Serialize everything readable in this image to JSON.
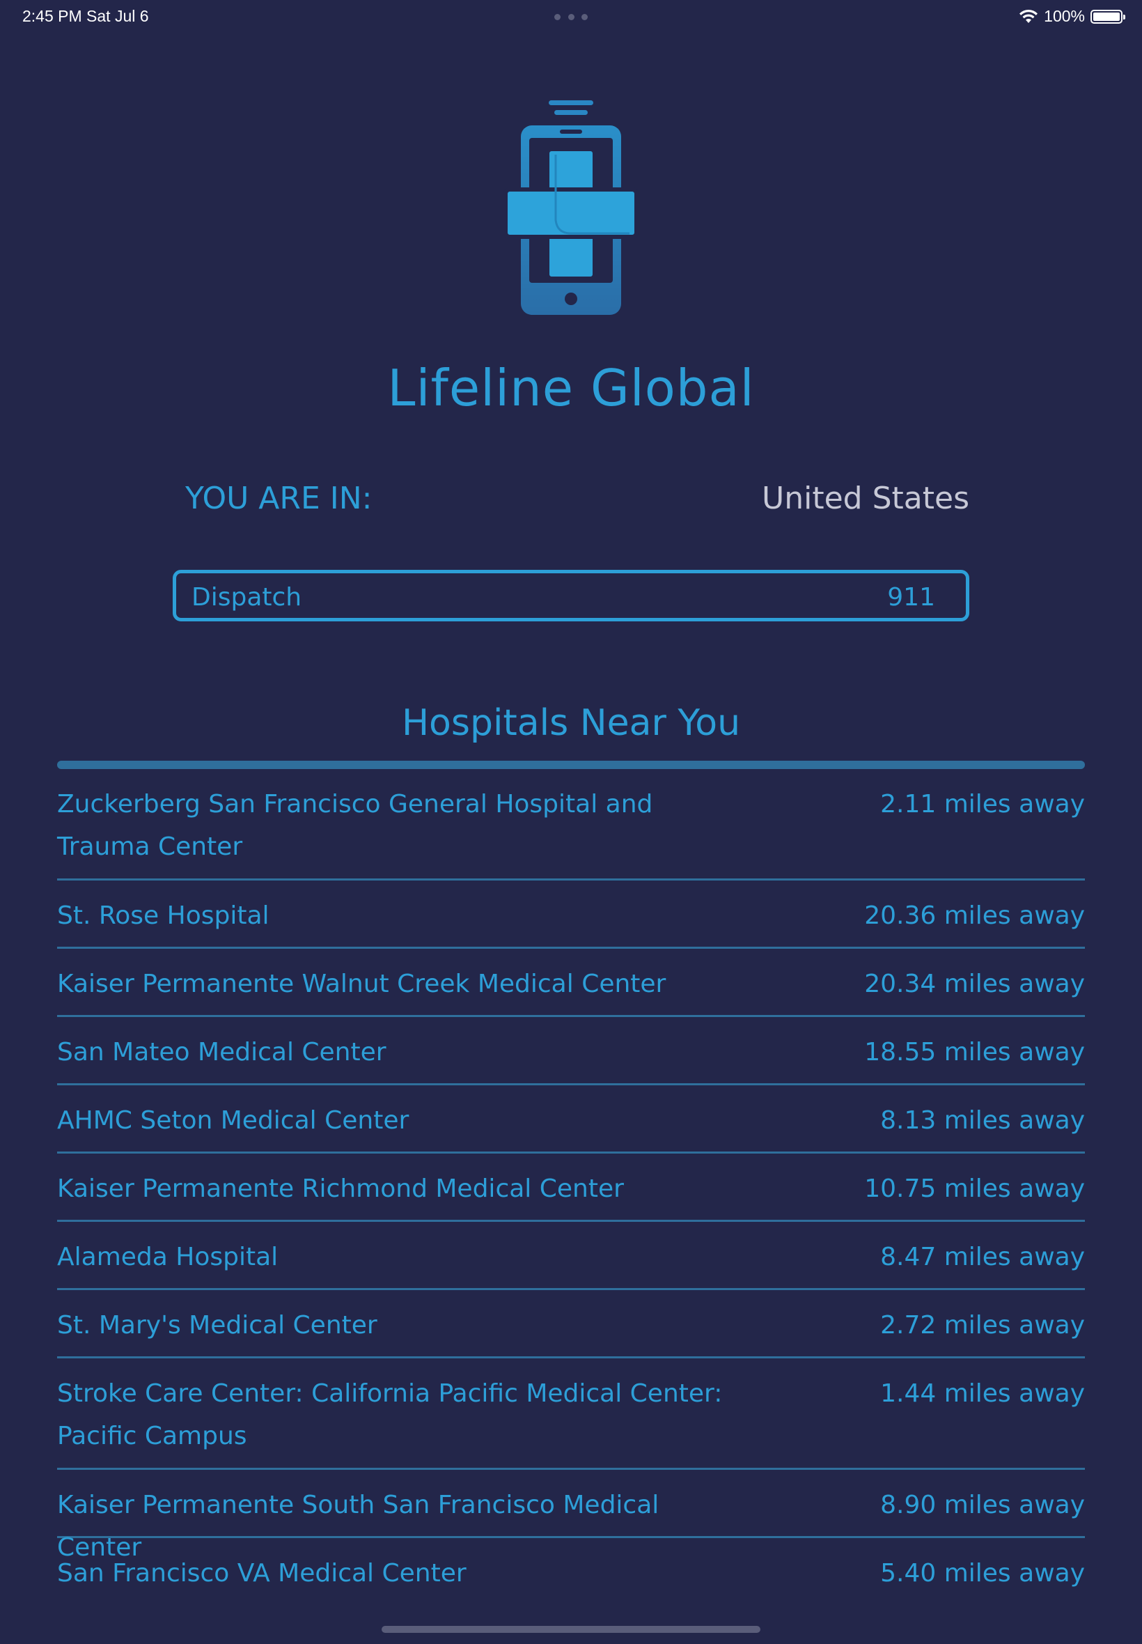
{
  "status_bar": {
    "time": "2:45 PM   Sat Jul 6",
    "battery": "100%"
  },
  "app": {
    "title": "Lifeline Global",
    "accent_color": "#2d9fd8",
    "background_color": "#23264a",
    "logo_icon": "phone-medical-cross-icon"
  },
  "location": {
    "label": "YOU ARE IN:",
    "value": "United States"
  },
  "dispatch": {
    "label": "Dispatch",
    "number": "911"
  },
  "hospitals": {
    "title": "Hospitals Near You",
    "items": [
      {
        "name": "Zuckerberg San Francisco General Hospital and Trauma Center",
        "distance": "2.11 miles away"
      },
      {
        "name": "St. Rose Hospital",
        "distance": "20.36 miles away"
      },
      {
        "name": "Kaiser Permanente Walnut Creek Medical Center",
        "distance": "20.34 miles away"
      },
      {
        "name": "San Mateo Medical Center",
        "distance": "18.55 miles away"
      },
      {
        "name": "AHMC Seton Medical Center",
        "distance": "8.13 miles away"
      },
      {
        "name": "Kaiser Permanente Richmond Medical Center",
        "distance": "10.75 miles away"
      },
      {
        "name": "Alameda Hospital",
        "distance": "8.47 miles away"
      },
      {
        "name": "St. Mary's Medical Center",
        "distance": "2.72 miles away"
      },
      {
        "name": "Stroke Care Center: California Pacific Medical Center: Pacific Campus",
        "distance": "1.44 miles away"
      },
      {
        "name": "Kaiser Permanente South San Francisco Medical Center",
        "distance": "8.90 miles away"
      },
      {
        "name": "San Francisco VA Medical Center",
        "distance": "5.40 miles away"
      }
    ]
  }
}
